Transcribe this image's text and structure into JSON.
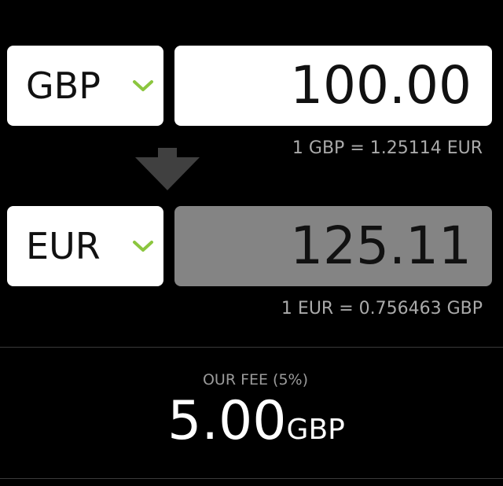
{
  "from": {
    "currency": "GBP",
    "amount": "100.00",
    "rate_text": "1 GBP = 1.25114 EUR",
    "chevron_icon": "chevron-down-icon"
  },
  "to": {
    "currency": "EUR",
    "amount": "125.11",
    "rate_text": "1 EUR = 0.756463 GBP",
    "chevron_icon": "chevron-down-icon"
  },
  "swap_icon": "arrow-down-icon",
  "fee": {
    "label": "OUR FEE (5%)",
    "amount": "5.00",
    "currency": "GBP"
  },
  "colors": {
    "background": "#000000",
    "accent_chevron": "#8cc63f",
    "output_box": "#848484",
    "arrow": "#404040"
  }
}
